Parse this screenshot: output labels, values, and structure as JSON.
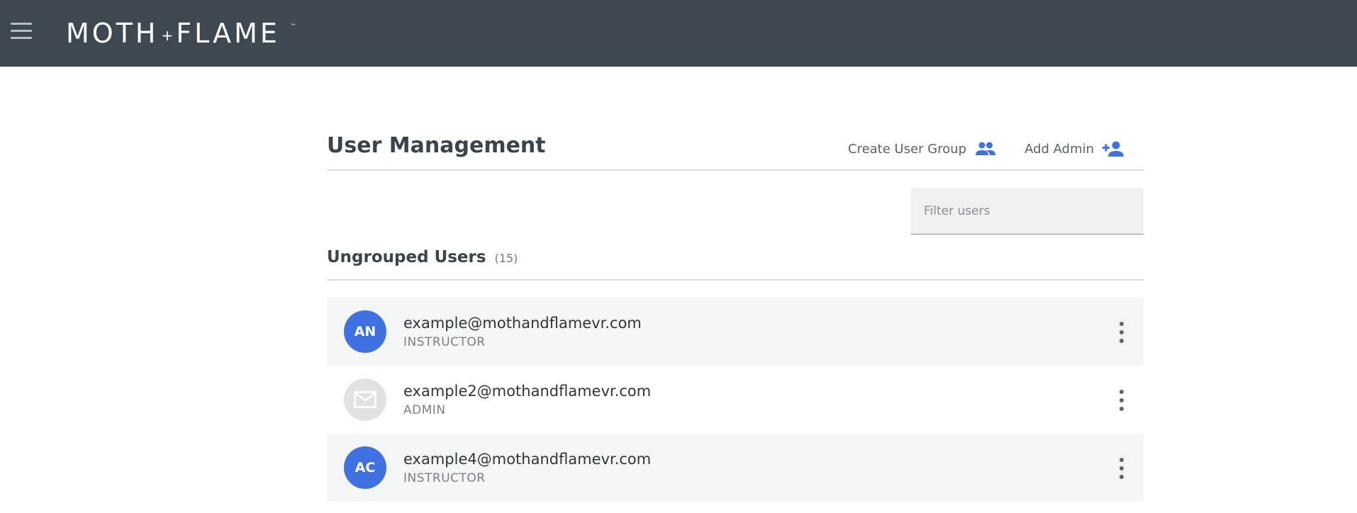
{
  "header": {
    "logo": {
      "left_word": "MOTH",
      "plus": "+",
      "right_word": "FLAME",
      "trademark": "™"
    }
  },
  "page": {
    "title": "User Management",
    "actions": {
      "create_group_label": "Create User Group",
      "add_admin_label": "Add Admin"
    },
    "filter": {
      "placeholder": "Filter users",
      "value": ""
    }
  },
  "section": {
    "title": "Ungrouped Users",
    "count": "(15)"
  },
  "users": [
    {
      "initials": "AN",
      "email": "example@mothandflamevr.com",
      "role": "INSTRUCTOR",
      "avatar": "initials"
    },
    {
      "initials": "",
      "email": "example2@mothandflamevr.com",
      "role": "ADMIN",
      "avatar": "mail-icon"
    },
    {
      "initials": "AC",
      "email": "example4@mothandflamevr.com",
      "role": "INSTRUCTOR",
      "avatar": "initials"
    }
  ],
  "colors": {
    "topbar": "#3e4850",
    "accent": "#4071e1",
    "row_shade": "#f4f6f5"
  }
}
